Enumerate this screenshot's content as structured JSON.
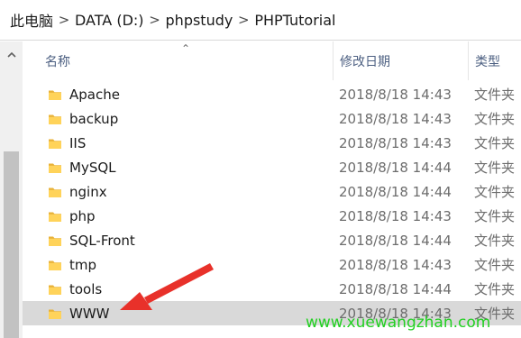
{
  "breadcrumb": [
    "此电脑",
    "DATA (D:)",
    "phpstudy",
    "PHPTutorial"
  ],
  "breadcrumb_separator": ">",
  "columns": {
    "name": "名称",
    "date": "修改日期",
    "type": "类型"
  },
  "rows": [
    {
      "name": "Apache",
      "date": "2018/8/18 14:43",
      "type": "文件夹",
      "icon": "folder-icon"
    },
    {
      "name": "backup",
      "date": "2018/8/18 14:43",
      "type": "文件夹",
      "icon": "folder-icon"
    },
    {
      "name": "IIS",
      "date": "2018/8/18 14:43",
      "type": "文件夹",
      "icon": "folder-icon"
    },
    {
      "name": "MySQL",
      "date": "2018/8/18 14:44",
      "type": "文件夹",
      "icon": "folder-icon"
    },
    {
      "name": "nginx",
      "date": "2018/8/18 14:44",
      "type": "文件夹",
      "icon": "folder-icon"
    },
    {
      "name": "php",
      "date": "2018/8/18 14:43",
      "type": "文件夹",
      "icon": "folder-icon"
    },
    {
      "name": "SQL-Front",
      "date": "2018/8/18 14:44",
      "type": "文件夹",
      "icon": "folder-icon"
    },
    {
      "name": "tmp",
      "date": "2018/8/18 14:43",
      "type": "文件夹",
      "icon": "folder-icon"
    },
    {
      "name": "tools",
      "date": "2018/8/18 14:44",
      "type": "文件夹",
      "icon": "folder-icon"
    },
    {
      "name": "WWW",
      "date": "2018/8/18 14:43",
      "type": "文件夹",
      "icon": "folder-icon",
      "selected": true
    }
  ],
  "watermark": "www.xuewangzhan.com",
  "colors": {
    "folder": "#ffd35a",
    "selected_row": "#d9d9d9",
    "header_text": "#4d6082",
    "arrow": "#e8312a",
    "watermark": "#22d022"
  }
}
